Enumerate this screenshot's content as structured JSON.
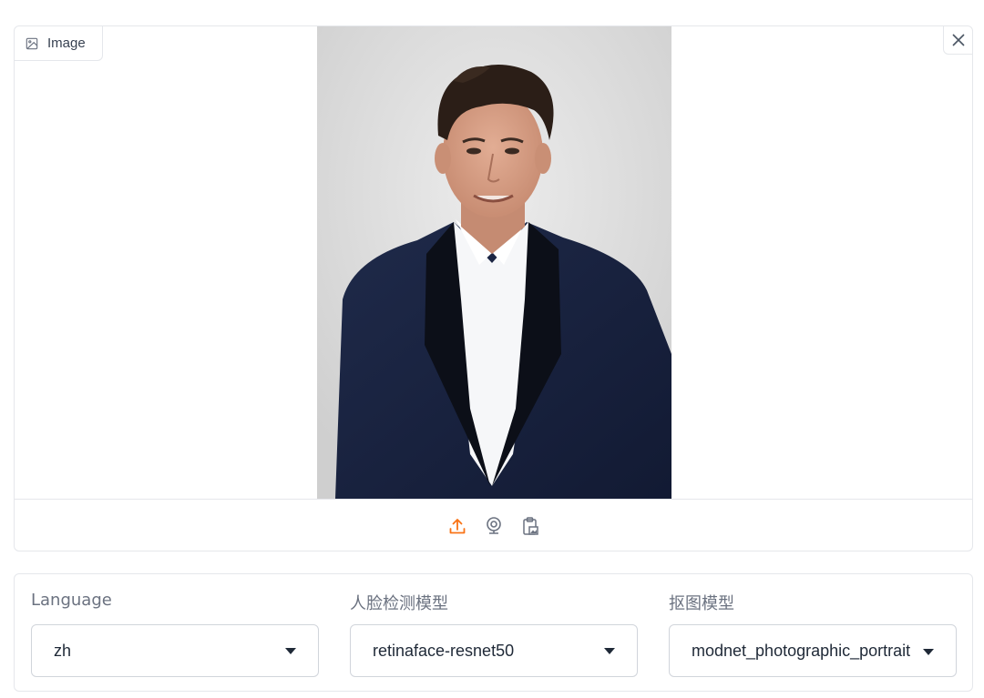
{
  "image_component": {
    "label": "Image",
    "label_icon": "image-icon",
    "close_icon": "close-icon",
    "toolbar": [
      {
        "name": "upload",
        "icon": "upload-icon",
        "color": "#f97316"
      },
      {
        "name": "webcam",
        "icon": "webcam-icon",
        "color": "#6b7280"
      },
      {
        "name": "clipboard",
        "icon": "clipboard-icon",
        "color": "#6b7280"
      }
    ]
  },
  "settings": {
    "language": {
      "label": "Language",
      "value": "zh"
    },
    "face_model": {
      "label": "人脸检测模型",
      "value": "retinaface-resnet50"
    },
    "matting_model": {
      "label": "抠图模型",
      "value": "modnet_photographic_portrait"
    }
  },
  "colors": {
    "accent": "#f97316",
    "border": "#e5e7eb",
    "label": "#6b7280"
  }
}
